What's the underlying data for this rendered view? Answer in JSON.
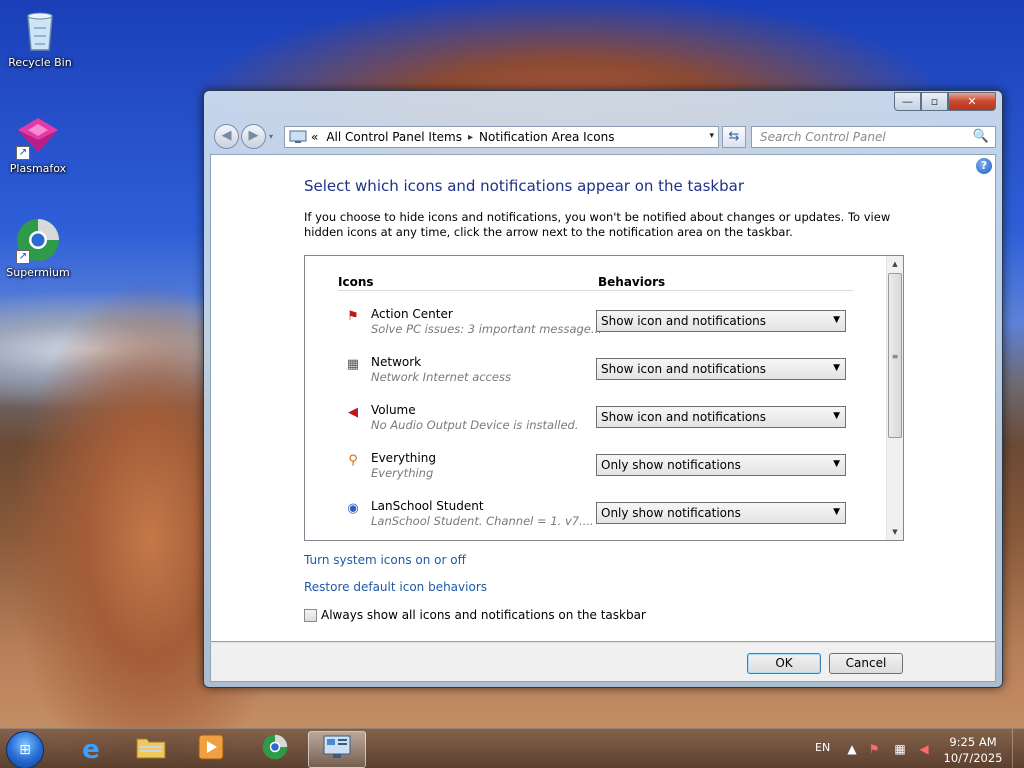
{
  "desktop": {
    "icons": [
      {
        "label": "Recycle Bin",
        "icon": "recycle-bin-icon"
      },
      {
        "label": "Plasmafox",
        "icon": "plasmafox-icon"
      },
      {
        "label": "Supermium",
        "icon": "supermium-icon"
      }
    ]
  },
  "window": {
    "controls": {
      "minimize": "—",
      "maximize": "▫",
      "close": "✕"
    },
    "nav": {
      "back": "◀",
      "forward": "▶",
      "dropdown": "▾"
    },
    "address": {
      "prefix": "«",
      "crumbs": [
        "All Control Panel Items",
        "Notification Area Icons"
      ],
      "separator": "▸",
      "dropdown": "▾"
    },
    "refresh": "⇆",
    "search": {
      "placeholder": "Search Control Panel",
      "icon": "🔍"
    },
    "help": "?",
    "heading": "Select which icons and notifications appear on the taskbar",
    "description": "If you choose to hide icons and notifications, you won't be notified about changes or updates. To view hidden icons at any time, click the arrow next to the notification area on the taskbar.",
    "columns": {
      "icons": "Icons",
      "behaviors": "Behaviors"
    },
    "rows": [
      {
        "name": "Action Center",
        "sub": "Solve PC issues: 3 important message...",
        "behavior": "Show icon and notifications",
        "icon": "action-center-icon"
      },
      {
        "name": "Network",
        "sub": "Network Internet access",
        "behavior": "Show icon and notifications",
        "icon": "network-icon"
      },
      {
        "name": "Volume",
        "sub": "No Audio Output Device is installed.",
        "behavior": "Show icon and notifications",
        "icon": "volume-icon"
      },
      {
        "name": "Everything",
        "sub": "Everything",
        "behavior": "Only show notifications",
        "icon": "everything-icon"
      },
      {
        "name": "LanSchool Student",
        "sub": "LanSchool Student.  Channel = 1.  v7....",
        "behavior": "Only show notifications",
        "icon": "lanschool-icon"
      }
    ],
    "links": {
      "system_icons": "Turn system icons on or off",
      "restore": "Restore default icon behaviors"
    },
    "checkbox_label": "Always show all icons and notifications on the taskbar",
    "buttons": {
      "ok": "OK",
      "cancel": "Cancel"
    }
  },
  "taskbar": {
    "language": "EN",
    "tray_arrow": "▲",
    "clock_time": "9:25 AM",
    "clock_date": "10/7/2025"
  }
}
